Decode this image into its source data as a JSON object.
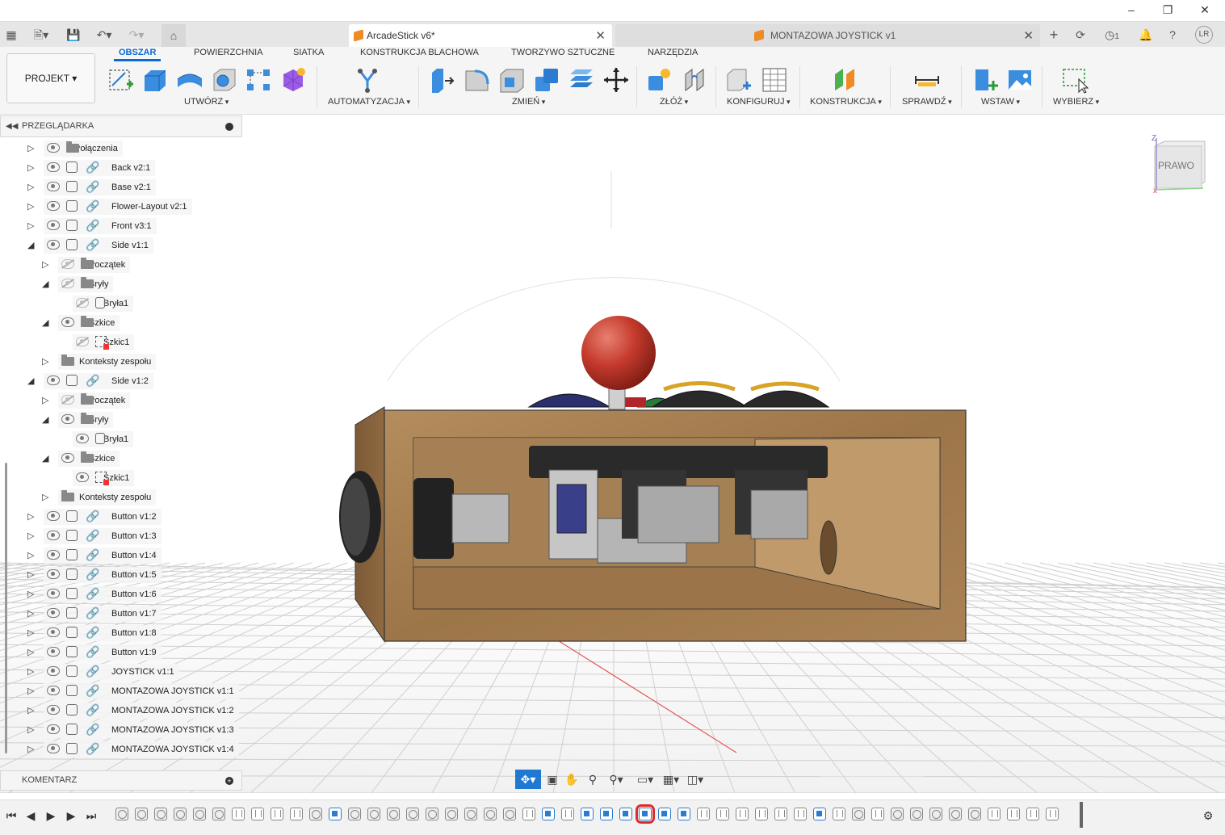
{
  "window": {
    "initials": "LR",
    "job_count": "1"
  },
  "tabs": [
    {
      "title": "ArcadeStick v6*",
      "active": true
    },
    {
      "title": "MONTAZOWA JOYSTICK v1",
      "active": false
    }
  ],
  "ribbon": {
    "workspace_button": "PROJEKT",
    "tabs": [
      "OBSZAR",
      "POWIERZCHNIA",
      "SIATKA",
      "KONSTRUKCJA BLACHOWA",
      "TWORZYWO SZTUCZNE",
      "NARZĘDZIA"
    ],
    "active_tab": "OBSZAR",
    "groups": [
      "UTWÓRZ",
      "AUTOMATYZACJA",
      "ZMIEŃ",
      "ZŁÓŻ",
      "KONFIGURUJ",
      "KONSTRUKCJA",
      "SPRAWDŹ",
      "WSTAW",
      "WYBIERZ"
    ]
  },
  "browser": {
    "title": "PRZEGLĄDARKA",
    "items": [
      {
        "label": "Połączenia",
        "indent": 0,
        "expand": "collapsed",
        "visible": true,
        "type": "folder"
      },
      {
        "label": "Back v2:1",
        "indent": 0,
        "expand": "collapsed",
        "visible": true,
        "type": "link"
      },
      {
        "label": "Base v2:1",
        "indent": 0,
        "expand": "collapsed",
        "visible": true,
        "type": "link"
      },
      {
        "label": "Flower-Layout v2:1",
        "indent": 0,
        "expand": "collapsed",
        "visible": true,
        "type": "link"
      },
      {
        "label": "Front v3:1",
        "indent": 0,
        "expand": "collapsed",
        "visible": true,
        "type": "link"
      },
      {
        "label": "Side v1:1",
        "indent": 0,
        "expand": "expanded",
        "visible": true,
        "type": "link"
      },
      {
        "label": "Początek",
        "indent": 1,
        "expand": "collapsed",
        "visible": false,
        "type": "folder"
      },
      {
        "label": "Bryły",
        "indent": 1,
        "expand": "expanded",
        "visible": false,
        "type": "folder"
      },
      {
        "label": "Bryła1",
        "indent": 2,
        "expand": "none",
        "visible": false,
        "type": "body"
      },
      {
        "label": "Szkice",
        "indent": 1,
        "expand": "expanded",
        "visible": true,
        "type": "folder"
      },
      {
        "label": "Szkic1",
        "indent": 2,
        "expand": "none",
        "visible": false,
        "type": "sketch"
      },
      {
        "label": "Konteksty zespołu",
        "indent": 1,
        "expand": "collapsed",
        "visible": null,
        "type": "folder"
      },
      {
        "label": "Side v1:2",
        "indent": 0,
        "expand": "expanded",
        "visible": true,
        "type": "link"
      },
      {
        "label": "Początek",
        "indent": 1,
        "expand": "collapsed",
        "visible": false,
        "type": "folder"
      },
      {
        "label": "Bryły",
        "indent": 1,
        "expand": "expanded",
        "visible": true,
        "type": "folder"
      },
      {
        "label": "Bryła1",
        "indent": 2,
        "expand": "none",
        "visible": true,
        "type": "body"
      },
      {
        "label": "Szkice",
        "indent": 1,
        "expand": "expanded",
        "visible": true,
        "type": "folder"
      },
      {
        "label": "Szkic1",
        "indent": 2,
        "expand": "none",
        "visible": true,
        "type": "sketch"
      },
      {
        "label": "Konteksty zespołu",
        "indent": 1,
        "expand": "collapsed",
        "visible": null,
        "type": "folder"
      },
      {
        "label": "Button v1:2",
        "indent": 0,
        "expand": "collapsed",
        "visible": true,
        "type": "link-grounded"
      },
      {
        "label": "Button v1:3",
        "indent": 0,
        "expand": "collapsed",
        "visible": true,
        "type": "link-grounded"
      },
      {
        "label": "Button v1:4",
        "indent": 0,
        "expand": "collapsed",
        "visible": true,
        "type": "link-grounded"
      },
      {
        "label": "Button v1:5",
        "indent": 0,
        "expand": "collapsed",
        "visible": true,
        "type": "link-grounded"
      },
      {
        "label": "Button v1:6",
        "indent": 0,
        "expand": "collapsed",
        "visible": true,
        "type": "link-grounded"
      },
      {
        "label": "Button v1:7",
        "indent": 0,
        "expand": "collapsed",
        "visible": true,
        "type": "link-grounded"
      },
      {
        "label": "Button v1:8",
        "indent": 0,
        "expand": "collapsed",
        "visible": true,
        "type": "link-grounded"
      },
      {
        "label": "Button v1:9",
        "indent": 0,
        "expand": "collapsed",
        "visible": true,
        "type": "link-grounded"
      },
      {
        "label": "JOYSTICK v1:1",
        "indent": 0,
        "expand": "collapsed",
        "visible": true,
        "type": "link-grounded"
      },
      {
        "label": "MONTAZOWA JOYSTICK v1:1",
        "indent": 0,
        "expand": "collapsed",
        "visible": true,
        "type": "link"
      },
      {
        "label": "MONTAZOWA JOYSTICK v1:2",
        "indent": 0,
        "expand": "collapsed",
        "visible": true,
        "type": "link"
      },
      {
        "label": "MONTAZOWA JOYSTICK v1:3",
        "indent": 0,
        "expand": "collapsed",
        "visible": true,
        "type": "link"
      },
      {
        "label": "MONTAZOWA JOYSTICK v1:4",
        "indent": 0,
        "expand": "collapsed",
        "visible": true,
        "type": "link"
      }
    ]
  },
  "comments": {
    "title": "KOMENTARZ"
  },
  "viewcube": {
    "face": "PRAWO",
    "axis_z": "Z"
  },
  "timeline": {
    "features": [
      "ext",
      "ext",
      "ext",
      "ext",
      "ext",
      "ext",
      "j",
      "j",
      "j",
      "j",
      "ext",
      "as",
      "ext",
      "ext",
      "ext",
      "ext",
      "ext",
      "ext",
      "ext",
      "ext",
      "ext",
      "j",
      "as",
      "j",
      "as",
      "as",
      "as",
      "as",
      "as",
      "as",
      "j",
      "j",
      "j",
      "j",
      "j",
      "j",
      "as",
      "j",
      "ext",
      "j",
      "ext",
      "ext",
      "ext",
      "ext",
      "ext",
      "j",
      "j",
      "j",
      "j"
    ],
    "selected_index": 27
  },
  "colors": {
    "accent": "#0b69d3",
    "timeline_selected": "#e02b2b",
    "wood": "#a07a4c"
  }
}
